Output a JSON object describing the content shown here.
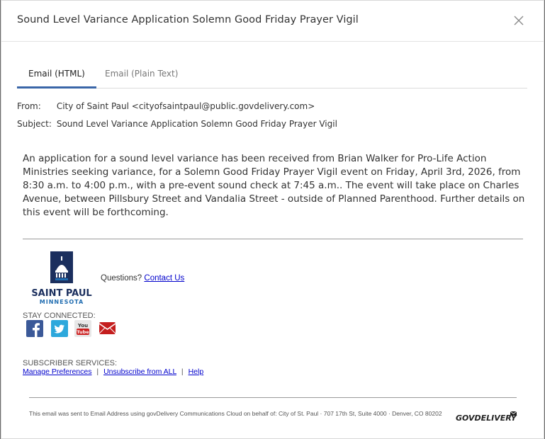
{
  "modal": {
    "title": "Sound Level Variance Application Solemn Good Friday Prayer Vigil"
  },
  "tabs": [
    {
      "label": "Email (HTML)",
      "active": true
    },
    {
      "label": "Email (Plain Text)",
      "active": false
    }
  ],
  "meta": {
    "from_label": "From:",
    "from_value": "City of Saint Paul <cityofsaintpaul@public.govdelivery.com>",
    "subject_label": "Subject:",
    "subject_value": "Sound Level Variance Application Solemn Good Friday Prayer Vigil"
  },
  "body": {
    "text": "An application for a sound level variance has been received from Brian Walker for Pro-Life Action Ministries seeking variance, for a Solemn Good Friday Prayer Vigil event on Friday, April 3rd, 2026, from 8:30 a.m. to 4:00 p.m., with a pre-event sound check at 7:45 a.m.. The event will take place on Charles Avenue, between Pillsbury Street and Vandalia Street - outside of Planned Parenthood. Further details on this event will be forthcoming."
  },
  "logo": {
    "line1": "SAINT PAUL",
    "line2": "MINNESOTA",
    "colors": {
      "navy": "#1b2f5e",
      "blue": "#1f6cb0"
    }
  },
  "footer": {
    "questions": "Questions?",
    "contact_link": "Contact Us",
    "stay_connected": "STAY CONNECTED:",
    "social_icons": [
      "facebook-icon",
      "twitter-icon",
      "youtube-icon",
      "email-icon"
    ],
    "subscriber_services": "SUBSCRIBER SERVICES:",
    "manage_preferences": "Manage Preferences",
    "sep": "|",
    "unsubscribe": "Unsubscribe from ALL",
    "help": "Help",
    "disclaimer": "This email was sent to Email Address using govDelivery Communications Cloud on behalf of: City of St. Paul · 707 17th St, Suite 4000 · Denver, CO 80202",
    "govdelivery": "GOVDELIVERY"
  }
}
